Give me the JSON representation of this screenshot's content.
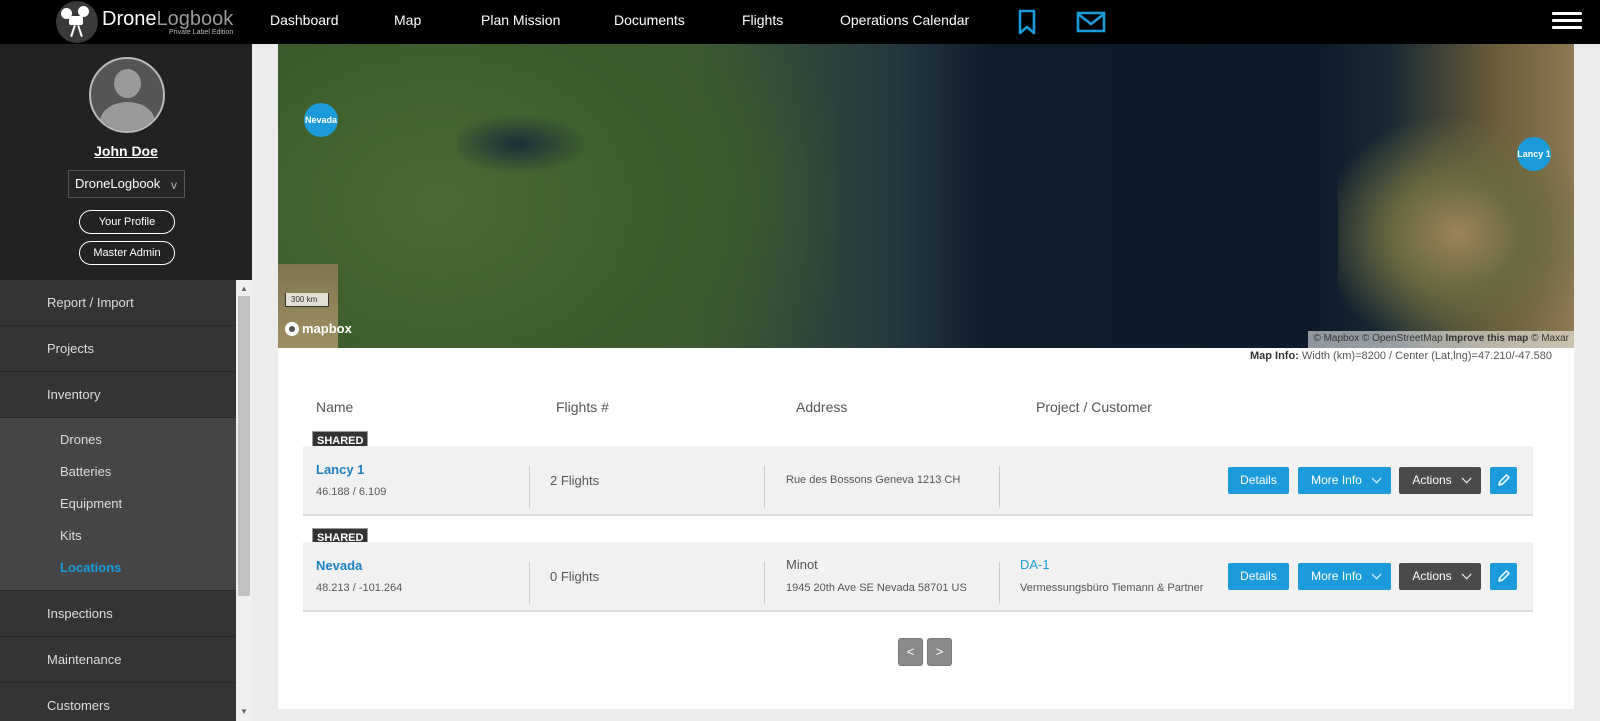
{
  "brand": {
    "name_a": "Drone",
    "name_b": "Logbook",
    "tagline": "Private Label Edition"
  },
  "nav": {
    "links": [
      "Dashboard",
      "Map",
      "Plan Mission",
      "Documents",
      "Flights",
      "Operations Calendar"
    ],
    "icons": [
      "bookmark-icon",
      "mail-icon",
      "hamburger-menu-icon"
    ],
    "accent": "#1b9bd9"
  },
  "profile": {
    "name": "John Doe",
    "org": "DroneLogbook",
    "org_chevron": "v",
    "buttons": [
      "Your Profile",
      "Master Admin"
    ]
  },
  "sidebar": {
    "items": [
      "Report / Import",
      "Projects",
      "Inventory"
    ],
    "inventory_sub": [
      "Drones",
      "Batteries",
      "Equipment",
      "Kits",
      "Locations"
    ],
    "active_sub": "Locations",
    "items_after": [
      "Inspections",
      "Maintenance",
      "Customers"
    ]
  },
  "map": {
    "markers": [
      {
        "label": "Nevada"
      },
      {
        "label": "Lancy 1"
      }
    ],
    "scale_label": "300 km",
    "logo": "mapbox",
    "attribution_a": "© Mapbox © OpenStreetMap",
    "attribution_improve": "Improve this map",
    "attribution_b": "© Maxar",
    "info_label": "Map Info:",
    "info_value": "Width (km)=8200 / Center (Lat,lng)=47.210/-47.580"
  },
  "table": {
    "headers": [
      "Name",
      "Flights #",
      "Address",
      "Project / Customer"
    ],
    "rows": [
      {
        "tag": "SHARED",
        "name": "Lancy 1",
        "coords": "46.188 / 6.109",
        "flights": "2 Flights",
        "address_line1": "",
        "address_line2": "Rue des Bossons Geneva 1213 CH",
        "project": "",
        "customer": ""
      },
      {
        "tag": "SHARED",
        "name": "Nevada",
        "coords": "48.213 / -101.264",
        "flights": "0 Flights",
        "address_line1": "Minot",
        "address_line2": "1945 20th Ave SE Nevada 58701 US",
        "project": "DA-1",
        "customer": "Vermessungsbüro Tiemann & Partner"
      }
    ],
    "buttons": {
      "details": "Details",
      "more_info": "More Info",
      "actions": "Actions"
    }
  },
  "pager": {
    "prev": "<",
    "next": ">"
  }
}
